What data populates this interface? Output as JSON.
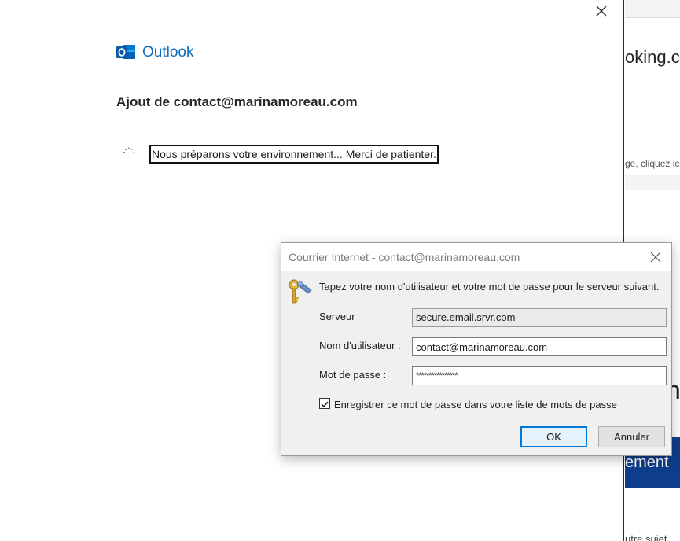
{
  "background_page": {
    "heading_fragment": "oking.c",
    "subtext_fragment": "ge, cliquez ic",
    "big_letter_fragment": "n",
    "banner_fragment": "ement",
    "footer_fragment": "utre sujet"
  },
  "outlook_window": {
    "brand": "Outlook",
    "title": "Ajout de contact@marinamoreau.com",
    "status_message": "Nous préparons votre environnement... Merci de patienter.",
    "close_icon": "close-icon"
  },
  "credentials_dialog": {
    "title": "Courrier Internet - contact@marinamoreau.com",
    "prompt": "Tapez votre nom d'utilisateur et votre mot de passe pour le serveur suivant.",
    "server": {
      "label": "Serveur",
      "value": "secure.email.srvr.com"
    },
    "username": {
      "label": "Nom d'utilisateur :",
      "value": "contact@marinamoreau.com"
    },
    "password": {
      "label": "Mot de passe :",
      "value": "****************"
    },
    "remember": {
      "label": "Enregistrer ce mot de passe dans votre liste de mots de passe",
      "checked": true
    },
    "ok_label": "OK",
    "cancel_label": "Annuler"
  },
  "colors": {
    "outlook_blue": "#0f6cbd",
    "banner_blue": "#0f3d8c",
    "focus_border": "#0078d7",
    "dialog_bg": "#f0f0f0"
  }
}
